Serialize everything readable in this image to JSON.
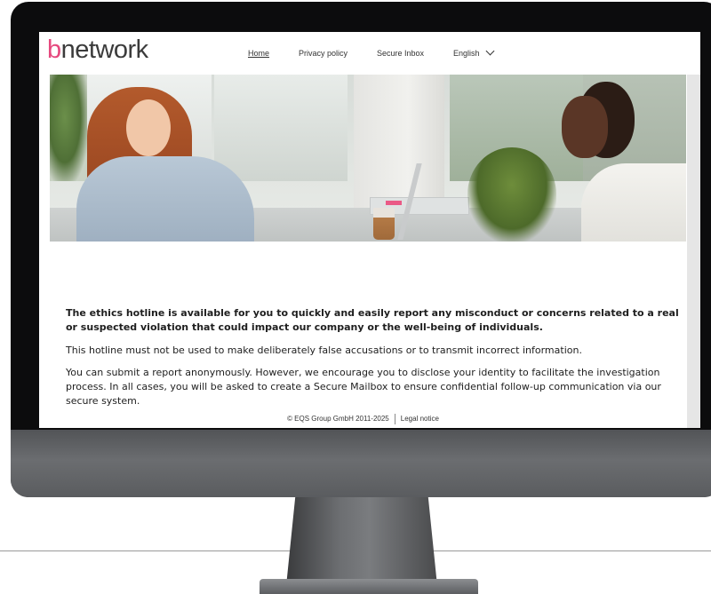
{
  "header": {
    "logo_prefix": "b",
    "logo_rest": "network",
    "nav": {
      "home": "Home",
      "privacy": "Privacy policy",
      "inbox": "Secure Inbox",
      "language": "English"
    }
  },
  "content": {
    "intro": "The ethics hotline is available for you to quickly and easily report any misconduct or concerns related to a real or suspected violation that could impact our company or the well-being of individuals.",
    "warning": "This hotline must not be used to make deliberately false accusations or to transmit incorrect information.",
    "anonymous": "You can submit a report anonymously. However, we encourage you to disclose your identity to facilitate the investigation process. In all cases, you will be asked to create a Secure Mailbox to ensure confidential follow-up communication via our secure system."
  },
  "footer": {
    "copyright": "© EQS Group GmbH 2011-2025",
    "legal": "Legal notice"
  },
  "colors": {
    "brand_accent": "#e6497e",
    "text": "#1e1e1e"
  },
  "icons": {
    "language_dropdown": "chevron-down-icon"
  }
}
